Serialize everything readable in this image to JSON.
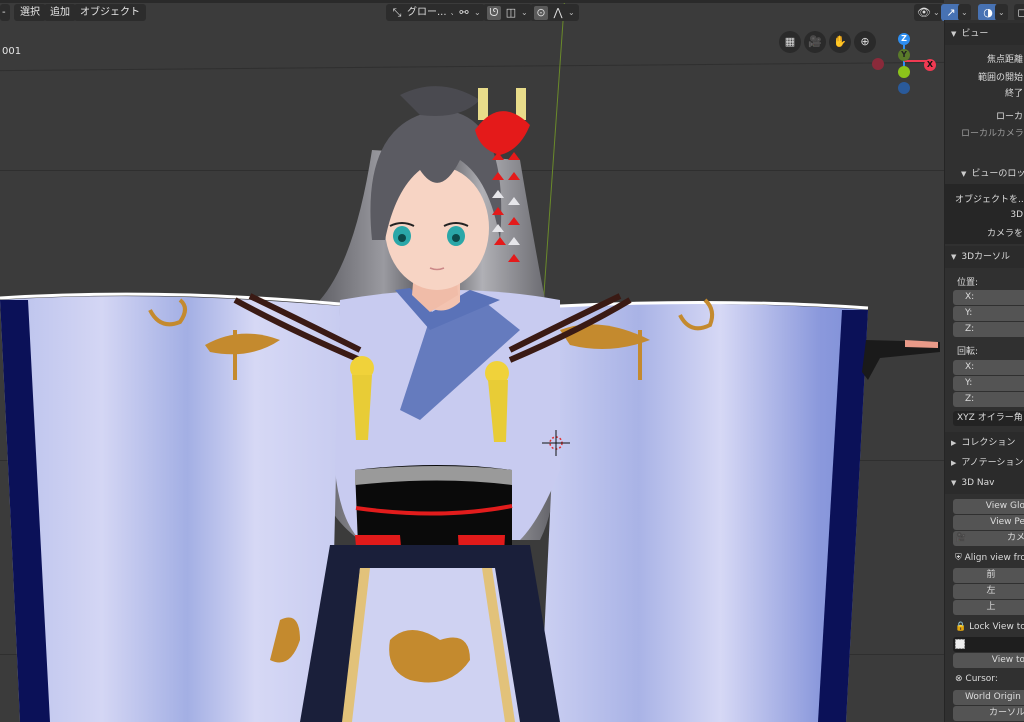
{
  "header": {
    "menus": [
      "選択",
      "追加",
      "オブジェクト"
    ],
    "transform_orientation": "グロー...",
    "object_name_suffix": "001"
  },
  "toolbar_icons": {
    "orientation_icon": "transform-orientation-icon",
    "pivot_icon": "pivot-point-icon",
    "snap_icon": "snap-icon",
    "snap_target_icon": "snap-increment-icon",
    "proportional_icon": "proportional-editing-icon",
    "falloff_icon": "falloff-curve-icon"
  },
  "right_header": {
    "visibility_icon": "visibility-icon",
    "gizmo_icon": "gizmo-toggle-icon",
    "overlay_icon": "overlay-icon",
    "accent_color": "#4772b3"
  },
  "nav_buttons": [
    "grid-view-icon",
    "camera-icon",
    "hand-pan-icon",
    "zoom-icon"
  ],
  "gizmo": {
    "z_label": "Z",
    "y_label": "Y",
    "x_label": "X",
    "colors": {
      "x": "#f03a52",
      "y": "#8cc31b",
      "z": "#2e8ef0"
    }
  },
  "panel": {
    "view": {
      "title": "ビュー",
      "focal_length": "焦点距離",
      "clip_start": "範囲の開始",
      "clip_end": "終了",
      "local_camera": "ローカ",
      "local_camera_sub": "ローカルカメラ"
    },
    "view_lock": {
      "title": "ビューのロッ",
      "lock_object": "オブジェクトを...",
      "lock_3d": "3D",
      "lock_camera": "カメラを"
    },
    "cursor": {
      "title": "3Dカーソル",
      "location_label": "位置:",
      "location": [
        "X:",
        "Y:",
        "Z:"
      ],
      "rotation_label": "回転:",
      "rotation": [
        "X:",
        "Y:",
        "Z:"
      ],
      "rotation_mode": "XYZ オイラー角"
    },
    "collections_title": "コレクション",
    "annotations_title": "アノテーション",
    "nav3d": {
      "title": "3D Nav",
      "view_global": "View Glo",
      "view_persp": "View Pe",
      "camera": "カメ",
      "align_view": "Align view fro",
      "front": "前",
      "left": "左",
      "top": "上",
      "lock_view": "Lock View to",
      "view_to": "View to",
      "cursor_label": "Cursor:",
      "world_origin": "World Origin",
      "cursor_to": "カーソル"
    }
  }
}
